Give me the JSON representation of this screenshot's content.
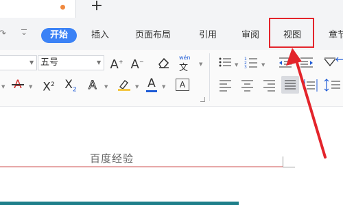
{
  "title_bar": {
    "new_tab": "+"
  },
  "menu": {
    "tabs": [
      "开始",
      "插入",
      "页面布局",
      "引用",
      "审阅",
      "视图",
      "章节"
    ],
    "active": "开始",
    "highlighted": "视图"
  },
  "ribbon": {
    "font_size": "五号",
    "pinyin_guide": "wén",
    "format_buttons": [
      "A",
      "A",
      "X²",
      "X₂",
      "A"
    ],
    "font_color": "#d4322f",
    "highlight_color": "#f4c542",
    "text_color": "#1e5bd6"
  },
  "document": {
    "text": "百度经验"
  },
  "colors": {
    "accent": "#3b82f6",
    "annotation": "#e3242b",
    "bottom_bar": "#1e7f8a"
  }
}
